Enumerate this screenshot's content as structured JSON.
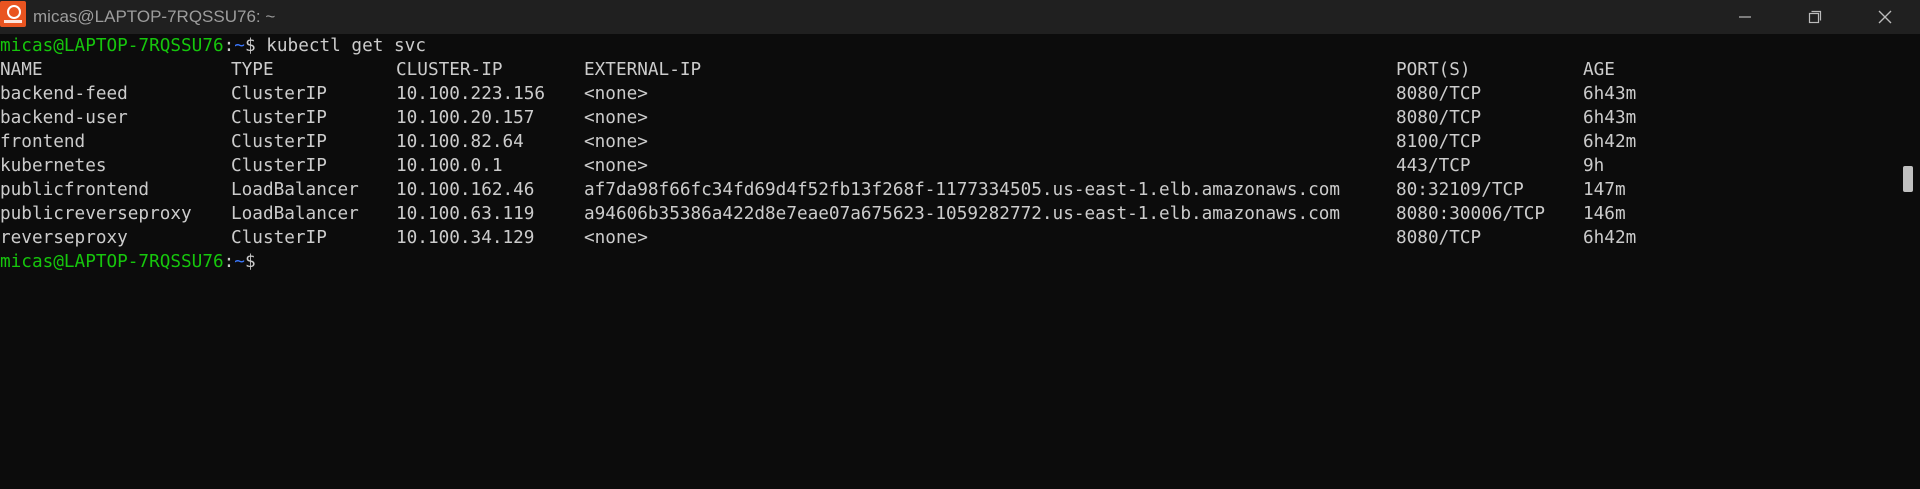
{
  "window": {
    "title": "micas@LAPTOP-7RQSSU76: ~",
    "app_icon": "ubuntu-icon",
    "controls": [
      "minimize-icon",
      "maximize-icon",
      "close-icon"
    ]
  },
  "prompt": {
    "user_host": "micas@LAPTOP-7RQSSU76",
    "separator": ":",
    "path": "~",
    "dollar": "$",
    "command": " kubectl get svc"
  },
  "table": {
    "headers": [
      "NAME",
      "TYPE",
      "CLUSTER-IP",
      "EXTERNAL-IP",
      "PORT(S)",
      "AGE"
    ],
    "rows": [
      [
        "backend-feed",
        "ClusterIP",
        "10.100.223.156",
        "<none>",
        "8080/TCP",
        "6h43m"
      ],
      [
        "backend-user",
        "ClusterIP",
        "10.100.20.157",
        "<none>",
        "8080/TCP",
        "6h43m"
      ],
      [
        "frontend",
        "ClusterIP",
        "10.100.82.64",
        "<none>",
        "8100/TCP",
        "6h42m"
      ],
      [
        "kubernetes",
        "ClusterIP",
        "10.100.0.1",
        "<none>",
        "443/TCP",
        "9h"
      ],
      [
        "publicfrontend",
        "LoadBalancer",
        "10.100.162.46",
        "af7da98f66fc34fd69d4f52fb13f268f-1177334505.us-east-1.elb.amazonaws.com",
        "80:32109/TCP",
        "147m"
      ],
      [
        "publicreverseproxy",
        "LoadBalancer",
        "10.100.63.119",
        "a94606b35386a422d8e7eae07a675623-1059282772.us-east-1.elb.amazonaws.com",
        "8080:30006/TCP",
        "146m"
      ],
      [
        "reverseproxy",
        "ClusterIP",
        "10.100.34.129",
        "<none>",
        "8080/TCP",
        "6h42m"
      ]
    ]
  },
  "colors": {
    "background": "#0c0c0c",
    "titlebar": "#202020",
    "text": "#cccccc",
    "prompt_user": "#16c60c",
    "prompt_path": "#3b78ff"
  }
}
